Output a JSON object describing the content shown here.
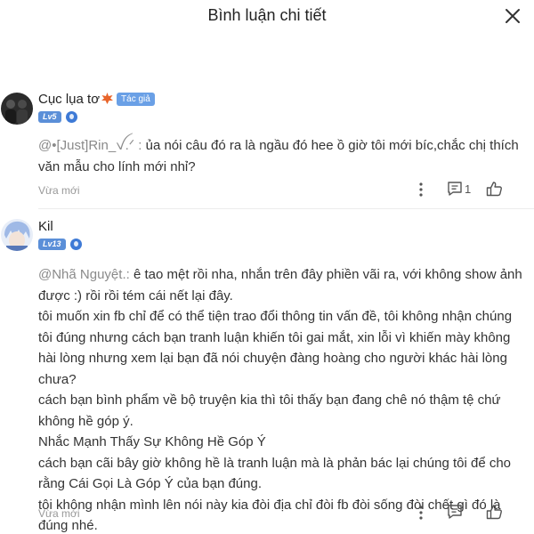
{
  "header": {
    "title": "Bình luận chi tiết"
  },
  "comments": [
    {
      "user": "Cục lụa tơ",
      "author_tag": "Tác giả",
      "level": "Lv5",
      "mention": "@•[Just]Rin_ꪜ.ᐟ :",
      "text": " ủa nói câu đó ra là ngầu đó hee ồ giờ tôi mới bíc,chắc chị thích văn mẫu cho lính mới nhỉ?",
      "time": "Vừa mới",
      "reply_count": "1"
    },
    {
      "user": "Kil",
      "level": "Lv13",
      "mention": "@Nhã Nguyệt.:",
      "lines": [
        " ê tao mệt rồi nha, nhắn trên đây phiền vãi ra, với không show ảnh được :) rồi rồi tém cái nết lại đây.",
        "tôi muốn xin fb chỉ để có thể tiện trao đổi thông tin vấn đề, tôi không nhận chúng tôi đúng nhưng cách bạn tranh luận khiến tôi gai mắt, xin lỗi vì khiến mày không hài lòng nhưng xem lại bạn đã nói chuyện đàng hoàng cho người khác hài lòng chưa?",
        "cách bạn bình phẩm về bộ truyện kia thì tôi thấy bạn đang chê nó thậm tệ chứ không hề góp ý.",
        "Nhắc Mạnh Thấy Sự Không Hề Góp Ý",
        "cách bạn cãi bây giờ không hề là tranh luận mà là phản bác lại chúng tôi để cho rằng Cái Gọi Là Góp Ý của bạn đúng.",
        "tôi không nhận mình lên nói này kia đòi địa chỉ đòi fb đòi sống đòi chết gì đó là đúng nhé."
      ],
      "time": "Vừa mới"
    }
  ],
  "icons": [
    "close-icon",
    "more-icon",
    "reply-icon",
    "like-icon",
    "leaf-icon",
    "vip-icon"
  ],
  "colors": {
    "author_tag": "#6aa0e6",
    "level_badge": "#5b8fd8",
    "mention": "#8a8a8a"
  }
}
